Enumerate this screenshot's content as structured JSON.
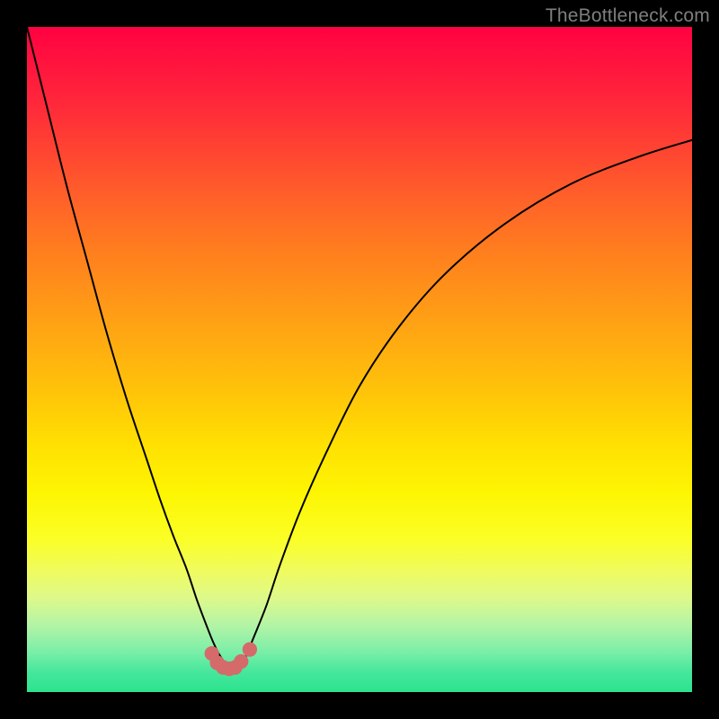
{
  "watermark": {
    "text": "TheBottleneck.com"
  },
  "chart_data": {
    "type": "line",
    "title": "",
    "xlabel": "",
    "ylabel": "",
    "xlim": [
      0,
      100
    ],
    "ylim": [
      0,
      100
    ],
    "grid": false,
    "legend": null,
    "background_gradient": {
      "direction": "vertical",
      "stops": [
        {
          "pct": 0,
          "color": "#ff0142"
        },
        {
          "pct": 12,
          "color": "#ff2a3a"
        },
        {
          "pct": 24,
          "color": "#ff5a2b"
        },
        {
          "pct": 34,
          "color": "#ff7f1e"
        },
        {
          "pct": 44,
          "color": "#ffa015"
        },
        {
          "pct": 55,
          "color": "#ffc409"
        },
        {
          "pct": 63,
          "color": "#ffe102"
        },
        {
          "pct": 70,
          "color": "#fdf502"
        },
        {
          "pct": 77,
          "color": "#fbff26"
        },
        {
          "pct": 82,
          "color": "#effb61"
        },
        {
          "pct": 86,
          "color": "#ddf98c"
        },
        {
          "pct": 90,
          "color": "#b2f4a6"
        },
        {
          "pct": 94,
          "color": "#7aeea8"
        },
        {
          "pct": 97,
          "color": "#45e79c"
        },
        {
          "pct": 100,
          "color": "#2ce38e"
        }
      ]
    },
    "series": [
      {
        "name": "bottleneck-curve",
        "color": "#000000",
        "x": [
          0,
          3,
          6,
          9,
          12,
          15,
          18,
          20,
          22,
          24,
          25.5,
          27,
          28,
          29,
          30,
          31,
          32,
          33,
          34,
          36,
          38,
          41,
          45,
          50,
          56,
          63,
          72,
          82,
          92,
          100
        ],
        "y": [
          100,
          88,
          76,
          65,
          54,
          44,
          35,
          29,
          23.5,
          18.5,
          14,
          10,
          7.5,
          5.5,
          4.2,
          3.7,
          4.2,
          5.5,
          8,
          13,
          19,
          27,
          36,
          46,
          55,
          63,
          70.5,
          76.5,
          80.5,
          83
        ]
      }
    ],
    "markers": [
      {
        "name": "trough-markers",
        "color": "#d46a6a",
        "radius": 1.1,
        "points": [
          {
            "x": 27.8,
            "y": 5.8
          },
          {
            "x": 28.6,
            "y": 4.4
          },
          {
            "x": 29.5,
            "y": 3.7
          },
          {
            "x": 30.4,
            "y": 3.5
          },
          {
            "x": 31.3,
            "y": 3.7
          },
          {
            "x": 32.2,
            "y": 4.6
          },
          {
            "x": 33.5,
            "y": 6.4
          }
        ]
      }
    ]
  }
}
